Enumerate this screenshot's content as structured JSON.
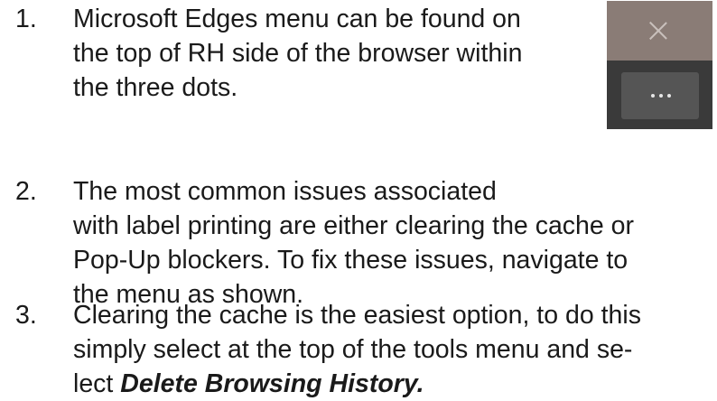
{
  "steps": [
    {
      "number": "1.",
      "lines": [
        "Microsoft Edges menu can be found on",
        "the top of RH side of the browser within",
        "the three dots."
      ]
    },
    {
      "number": "2.",
      "lines": [
        "The most common issues associated",
        "with label printing are either clearing the cache or",
        "Pop-Up blockers. To fix these issues,  navigate to",
        "the menu as shown."
      ]
    },
    {
      "number": "3.",
      "lines": [
        "Clearing the cache is the easiest option, to do this",
        "simply select at the top of the tools menu and se-",
        "lect "
      ],
      "emphasis": "Delete Browsing History."
    }
  ],
  "thumbnail": {
    "icons": [
      "close-icon",
      "more-icon"
    ],
    "colors": {
      "top_bar": "#8a7c76",
      "background": "#3a3a3a",
      "button": "#555555"
    }
  }
}
